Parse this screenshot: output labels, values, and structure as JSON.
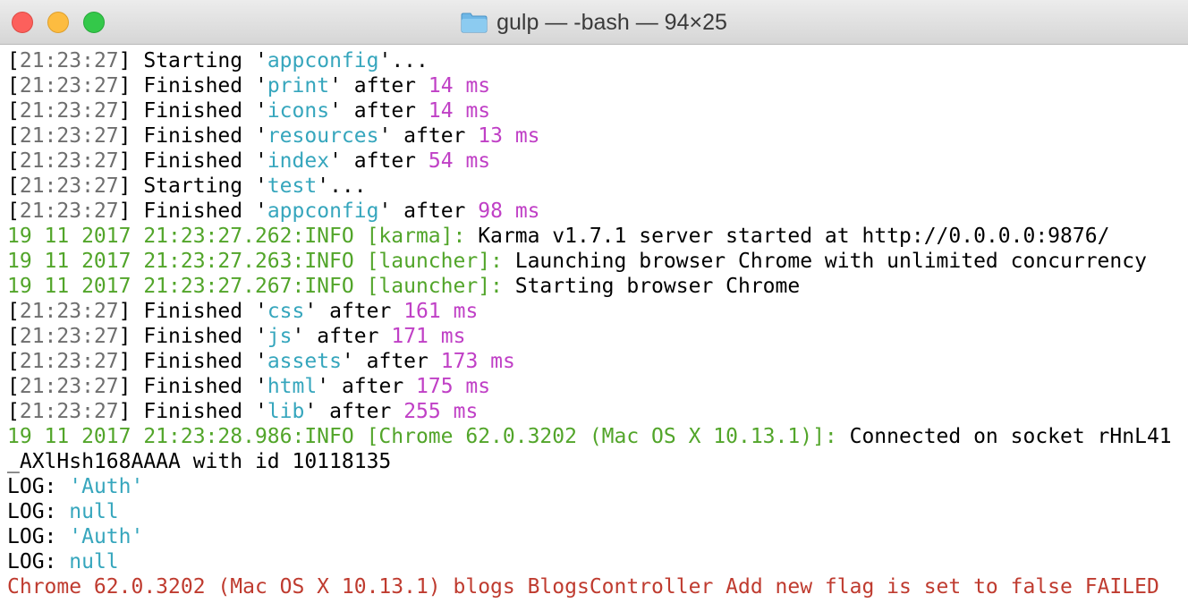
{
  "window": {
    "title": "gulp — -bash — 94×25"
  },
  "lines": [
    {
      "time": "21:23:27",
      "verb": "Starting",
      "name": "appconfig",
      "tail": "..."
    },
    {
      "time": "21:23:27",
      "verb": "Finished",
      "name": "print",
      "after": "after",
      "duration": "14 ms"
    },
    {
      "time": "21:23:27",
      "verb": "Finished",
      "name": "icons",
      "after": "after",
      "duration": "14 ms"
    },
    {
      "time": "21:23:27",
      "verb": "Finished",
      "name": "resources",
      "after": "after",
      "duration": "13 ms"
    },
    {
      "time": "21:23:27",
      "verb": "Finished",
      "name": "index",
      "after": "after",
      "duration": "54 ms"
    },
    {
      "time": "21:23:27",
      "verb": "Starting",
      "name": "test",
      "tail": "..."
    },
    {
      "time": "21:23:27",
      "verb": "Finished",
      "name": "appconfig",
      "after": "after",
      "duration": "98 ms"
    },
    {
      "prefix": "19 11 2017 21:23:27.262:INFO [karma]:",
      "message": " Karma v1.7.1 server started at http://0.0.0.0:9876/"
    },
    {
      "prefix": "19 11 2017 21:23:27.263:INFO [launcher]:",
      "message": " Launching browser Chrome with unlimited concurrency"
    },
    {
      "prefix": "19 11 2017 21:23:27.267:INFO [launcher]:",
      "message": " Starting browser Chrome"
    },
    {
      "time": "21:23:27",
      "verb": "Finished",
      "name": "css",
      "after": "after",
      "duration": "161 ms"
    },
    {
      "time": "21:23:27",
      "verb": "Finished",
      "name": "js",
      "after": "after",
      "duration": "171 ms"
    },
    {
      "time": "21:23:27",
      "verb": "Finished",
      "name": "assets",
      "after": "after",
      "duration": "173 ms"
    },
    {
      "time": "21:23:27",
      "verb": "Finished",
      "name": "html",
      "after": "after",
      "duration": "175 ms"
    },
    {
      "time": "21:23:27",
      "verb": "Finished",
      "name": "lib",
      "after": "after",
      "duration": "255 ms"
    },
    {
      "prefix": "19 11 2017 21:23:28.986:INFO [Chrome 62.0.3202 (Mac OS X 10.13.1)]:",
      "message": " Connected on socket rHnL41"
    },
    {
      "text": "_AXlHsh168AAAA with id 10118135"
    },
    {
      "label": "LOG: ",
      "value": "'Auth'"
    },
    {
      "label": "LOG: ",
      "value": "null"
    },
    {
      "label": "LOG: ",
      "value": "'Auth'"
    },
    {
      "label": "LOG: ",
      "value": "null"
    },
    {
      "error": "Chrome 62.0.3202 (Mac OS X 10.13.1) blogs BlogsController Add new flag is set to false FAILED"
    }
  ],
  "colors": {
    "timestamp": "#6e6e6e",
    "task_name": "#36a6bd",
    "duration": "#c040c6",
    "info": "#52a52a",
    "error": "#bf3b2f"
  },
  "icons": {
    "title_icon": "folder-icon"
  }
}
